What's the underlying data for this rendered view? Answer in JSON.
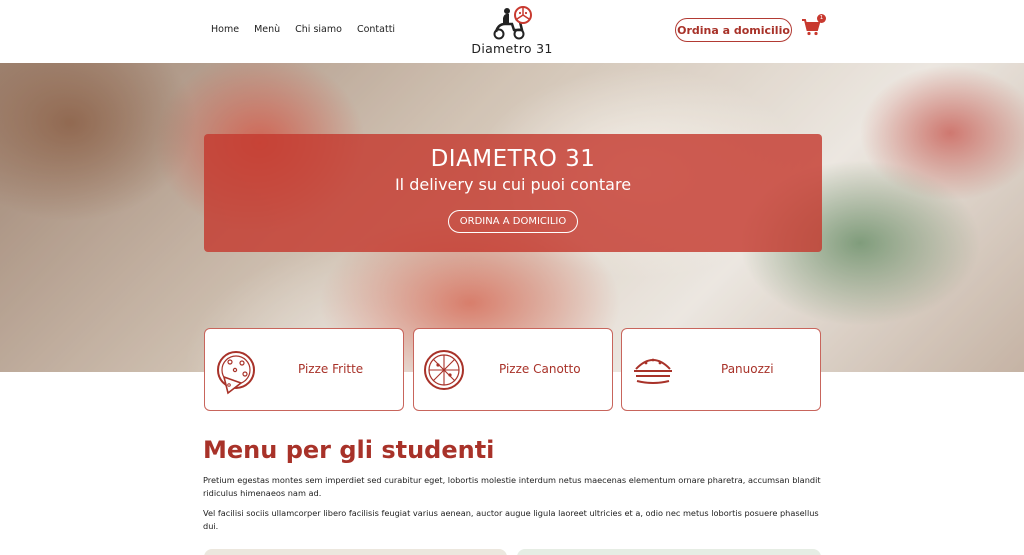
{
  "header": {
    "nav": [
      "Home",
      "Menù",
      "Chi siamo",
      "Contatti"
    ],
    "logo_text": "Diametro 31",
    "order_button": "Ordina a domicilio",
    "cart_count": "1"
  },
  "hero": {
    "title": "DIAMETRO 31",
    "subtitle": "Il delivery su cui puoi contare",
    "button": "ORDINA A DOMICILIO"
  },
  "categories": [
    {
      "label": "Pizze Fritte",
      "icon": "pizza-slice-icon"
    },
    {
      "label": "Pizze Canotto",
      "icon": "pizza-icon"
    },
    {
      "label": "Panuozzi",
      "icon": "panuozzo-icon"
    }
  ],
  "section": {
    "title": "Menu per gli studenti",
    "paragraphs": [
      "Pretium egestas montes sem imperdiet sed curabitur eget, lobortis molestie interdum netus maecenas elementum ornare pharetra, accumsan blandit ridiculus himenaeos nam ad.",
      "Vel facilisi sociis ullamcorper libero facilisis feugiat varius aenean, auctor augue ligula laoreet ultricies et a, odio nec metus lobortis posuere phasellus dui."
    ]
  },
  "colors": {
    "accent": "#a83229",
    "hero_overlay": "#c43a30"
  }
}
